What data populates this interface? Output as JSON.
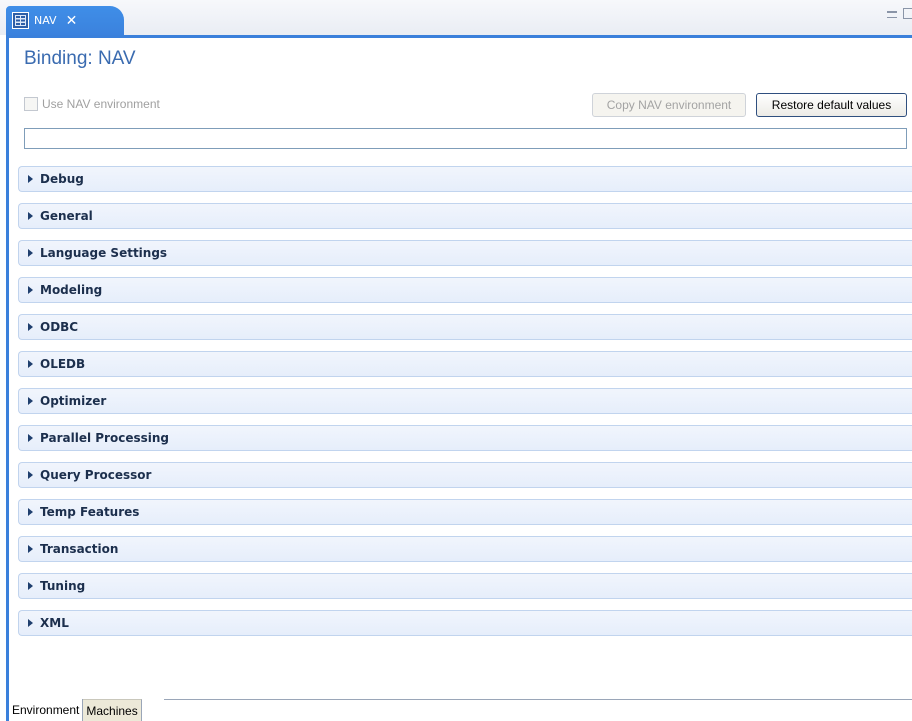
{
  "editor_tab": {
    "label": "NAV",
    "icon": "editor-grid-icon"
  },
  "page": {
    "title": "Binding: NAV"
  },
  "environment": {
    "use_nav_label": "Use NAV environment",
    "use_nav_checked": false,
    "copy_button_label": "Copy NAV environment",
    "restore_button_label": "Restore default values",
    "path_value": ""
  },
  "sections": [
    {
      "label": "Debug"
    },
    {
      "label": "General"
    },
    {
      "label": "Language Settings"
    },
    {
      "label": "Modeling"
    },
    {
      "label": "ODBC"
    },
    {
      "label": "OLEDB"
    },
    {
      "label": "Optimizer"
    },
    {
      "label": "Parallel Processing"
    },
    {
      "label": "Query Processor"
    },
    {
      "label": "Temp Features"
    },
    {
      "label": "Transaction"
    },
    {
      "label": "Tuning"
    },
    {
      "label": "XML"
    }
  ],
  "bottom_tabs": [
    {
      "label": "Environment",
      "active": true
    },
    {
      "label": "Machines",
      "active": false
    }
  ],
  "colors": {
    "accent": "#3a80db",
    "title": "#3a6bb0",
    "section_bg": "#e6eefb"
  }
}
